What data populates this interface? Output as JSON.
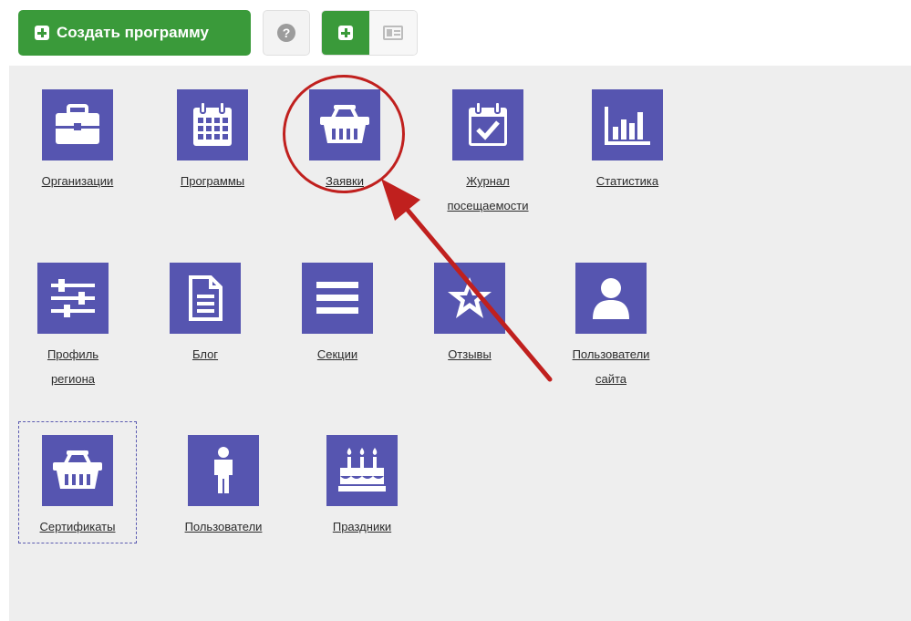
{
  "toolbar": {
    "create_label": "Создать программу",
    "help_symbol": "?"
  },
  "tiles": [
    {
      "label": "Организации",
      "icon": "briefcase-icon"
    },
    {
      "label": "Программы",
      "icon": "calendar-icon"
    },
    {
      "label": "Заявки",
      "icon": "basket-icon"
    },
    {
      "label_line1": "Журнал",
      "label_line2": "посещаемости",
      "icon": "calendar-check-icon"
    },
    {
      "label": "Статистика",
      "icon": "bar-chart-icon"
    },
    {
      "label_line1": "Профиль",
      "label_line2": "региона",
      "icon": "sliders-icon"
    },
    {
      "label": "Блог",
      "icon": "document-icon"
    },
    {
      "label": "Секции",
      "icon": "list-icon"
    },
    {
      "label": "Отзывы",
      "icon": "star-icon"
    },
    {
      "label_line1": "Пользователи",
      "label_line2": "сайта",
      "icon": "user-icon"
    },
    {
      "label": "Сертификаты",
      "icon": "basket-icon"
    },
    {
      "label": "Пользователи",
      "icon": "person-icon"
    },
    {
      "label": "Праздники",
      "icon": "cake-icon"
    }
  ],
  "colors": {
    "tile_bg": "#5655b0",
    "primary_green": "#3a9a3a",
    "highlight_red": "#c0201e",
    "panel_bg": "#eeeeee"
  }
}
